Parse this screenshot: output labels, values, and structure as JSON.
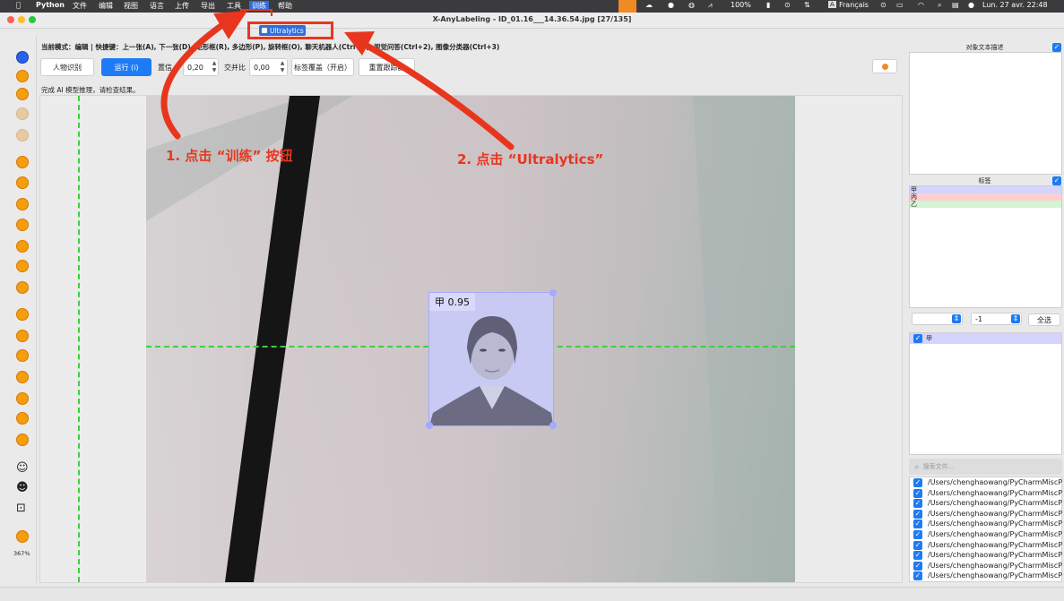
{
  "menubar": {
    "apple": "",
    "app": "Python",
    "items": [
      "文件",
      "编辑",
      "视图",
      "语言",
      "上传",
      "导出",
      "工具",
      "训练",
      "帮助"
    ],
    "status": [
      "100%",
      "Français",
      "Lun. 27 avr.  22:48"
    ]
  },
  "window": {
    "title": "X-AnyLabeling - ID_01.16___14.36.54.jpg [27/135]",
    "popup_tab": "Ultralytics"
  },
  "toolbar": {
    "mode_text": "当前模式：编辑 | 快捷键：上一张(A), 下一张(D), 矩形框(R), 多边形(P), 旋转框(O), 聊天机器人(Ctrl+1), 视觉问答(Ctrl+2), 图像分类器(Ctrl+3)",
    "person_btn": "人物识别",
    "run_btn": "运行 (i)",
    "confidence_label": "置信",
    "confidence_value": "0,20",
    "iou_label": "交并比",
    "iou_value": "0,00",
    "overlay_btn": "标签覆盖（开启）",
    "tracker_btn": "重置跟踪器",
    "status_text": "完成 AI 模型推理，请检查结果。"
  },
  "left_tools": {
    "zoom_label": "367%"
  },
  "canvas": {
    "box_label": "甲 0.95"
  },
  "annotations": {
    "step1": "1. 点击 “训练” 按钮",
    "step2": "2. 点击 “Ultralytics”"
  },
  "right": {
    "desc_title": "对象文本描述",
    "labels_title": "标签",
    "labels": [
      {
        "name": "甲",
        "color": "#d4d4ff"
      },
      {
        "name": "丙",
        "color": "#ffd0d0"
      },
      {
        "name": "乙",
        "color": "#d4f4d4"
      }
    ],
    "group_value": "-1",
    "select_all": "全选",
    "shape_item": "甲",
    "search_placeholder": "搜索文件...",
    "files": [
      "/Users/chenghaowang/PyCharmMiscProject",
      "/Users/chenghaowang/PyCharmMiscProject",
      "/Users/chenghaowang/PyCharmMiscProject",
      "/Users/chenghaowang/PyCharmMiscProject",
      "/Users/chenghaowang/PyCharmMiscProject",
      "/Users/chenghaowang/PyCharmMiscProject",
      "/Users/chenghaowang/PyCharmMiscProject",
      "/Users/chenghaowang/PyCharmMiscProject",
      "/Users/chenghaowang/PyCharmMiscProject",
      "/Users/chenghaowang/PyCharmMiscProject"
    ]
  },
  "colors": {
    "accent": "#1d7bf5",
    "annotation": "#e8361e",
    "box": "#a6a9ff",
    "guide": "#3bd13b"
  }
}
